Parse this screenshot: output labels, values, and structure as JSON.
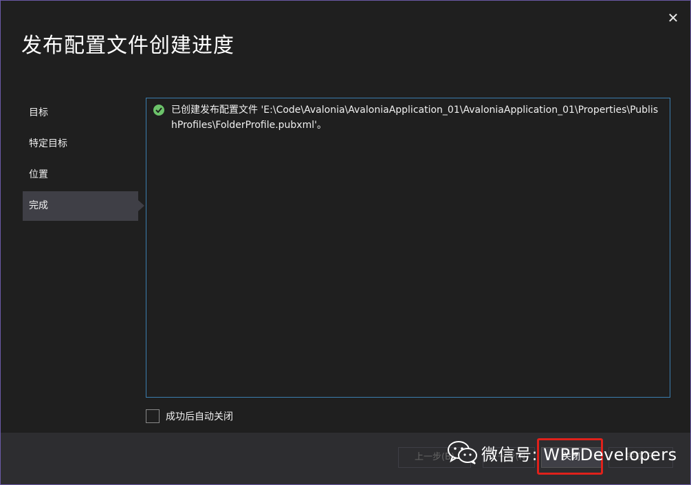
{
  "dialog": {
    "title": "发布配置文件创建进度",
    "close_glyph": "✕"
  },
  "nav": {
    "items": [
      {
        "label": "目标",
        "active": false
      },
      {
        "label": "特定目标",
        "active": false
      },
      {
        "label": "位置",
        "active": false
      },
      {
        "label": "完成",
        "active": true
      }
    ]
  },
  "log": {
    "status_icon": "check-circle-icon",
    "message": "已创建发布配置文件 'E:\\Code\\Avalonia\\AvaloniaApplication_01\\AvaloniaApplication_01\\Properties\\PublishProfiles\\FolderProfile.pubxml'。"
  },
  "options": {
    "auto_close_label": "成功后自动关闭",
    "auto_close_checked": false
  },
  "footer": {
    "prev_label": "上一步(B)",
    "next_label": "下一步(N)",
    "close_label": "关闭",
    "finish_label": "完成(F)"
  },
  "watermark": {
    "text": "微信号: WPFDevelopers",
    "icon": "wechat-icon"
  },
  "colors": {
    "background": "#1f1f1f",
    "footer": "#2d2d30",
    "log_border": "#3c7fb1",
    "success_green": "#6cc36a",
    "highlight_red": "#e0211b",
    "window_border": "#6b5aa8"
  }
}
